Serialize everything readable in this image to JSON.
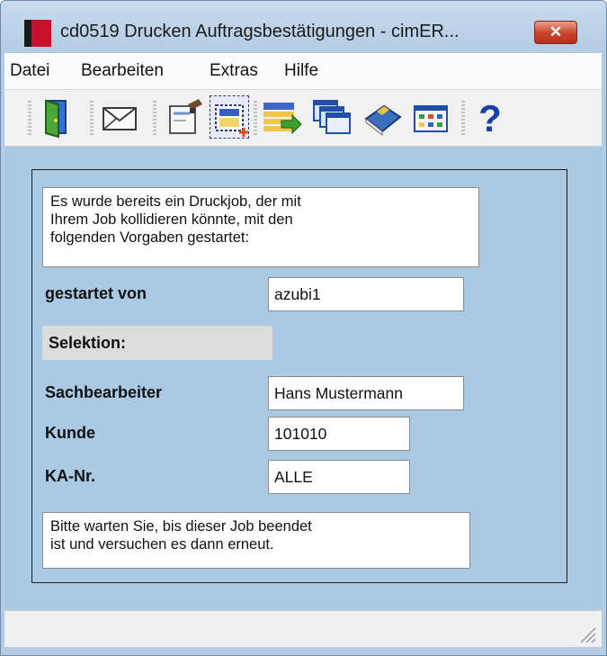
{
  "window": {
    "title": "cd0519 Drucken Auftragsbestätigungen - cimER...",
    "close_label": "✕"
  },
  "menu": [
    "Datei",
    "Bearbeiten",
    "Extras",
    "Hilfe"
  ],
  "toolbar": [
    "exit-door-icon",
    "mail-envelope-icon",
    "edit-form-icon",
    "new-record-icon",
    "transfer-list-icon",
    "windows-cascade-icon",
    "book-icon",
    "calendar-grid-icon",
    "help-question-icon"
  ],
  "dialog": {
    "intro": "Es wurde bereits ein Druckjob, der mit\nIhrem Job kollidieren könnte, mit den\nfolgenden Vorgaben gestartet:",
    "started_by_label": "gestartet von",
    "started_by_value": "azubi1",
    "selection_label": "Selektion:",
    "clerk_label": "Sachbearbeiter",
    "clerk_value": "Hans Mustermann",
    "customer_label": "Kunde",
    "customer_value": "101010",
    "ka_label": "KA-Nr.",
    "ka_value": "ALLE",
    "footer": "Bitte warten Sie, bis dieser Job beendet\nist und versuchen es dann erneut."
  },
  "colors": {
    "client_bg": "#aacae4",
    "accent_red": "#c8102e",
    "close_red": "#c8442a"
  }
}
